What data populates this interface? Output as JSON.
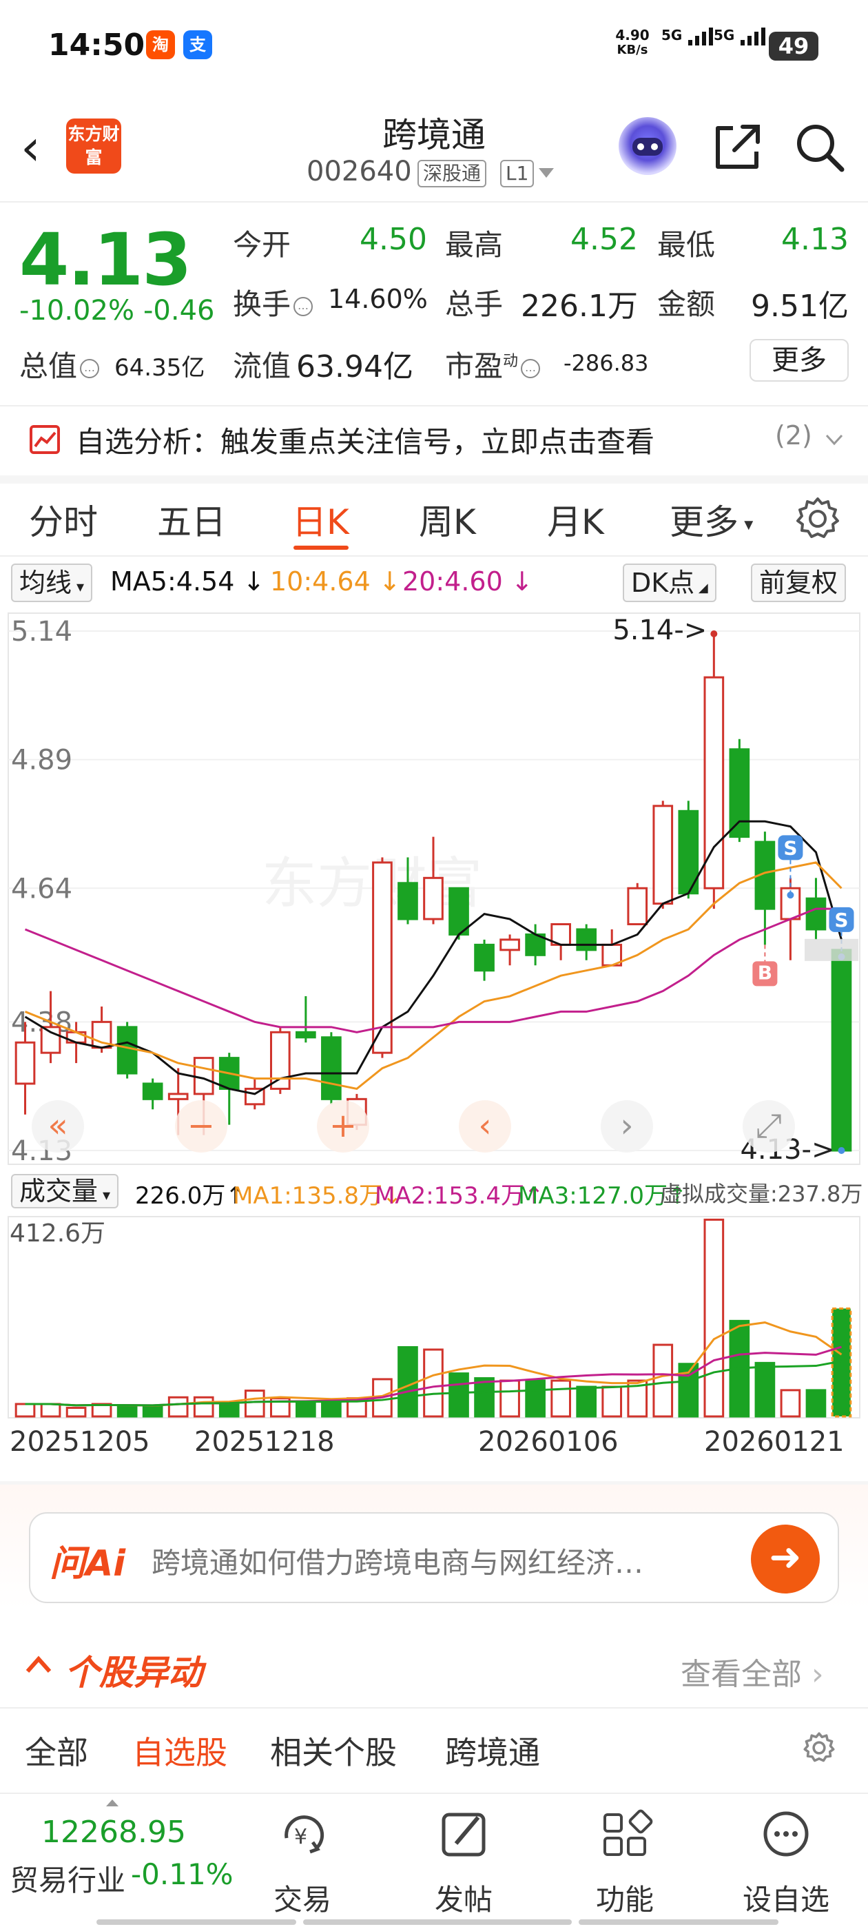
{
  "status_bar": {
    "time": "14:50",
    "apps": [
      {
        "label": "淘",
        "color": "#ff5000"
      },
      {
        "label": "支",
        "color": "#1677ff"
      }
    ],
    "net_speed": "4.90",
    "net_unit": "KB/s",
    "sig1": "5G",
    "sig2": "5G",
    "battery": "49"
  },
  "header": {
    "logo": "东方财富",
    "title": "跨境通",
    "code": "002640",
    "market_tag": "深股通",
    "level_tag": "L1"
  },
  "quote": {
    "price": "4.13",
    "change_pct": "-10.02%",
    "change": "-0.46",
    "open_label": "今开",
    "open": "4.50",
    "high_label": "最高",
    "high": "4.52",
    "low_label": "最低",
    "low": "4.13",
    "turnover_label": "换手",
    "turnover": "14.60%",
    "volume_label": "总手",
    "volume": "226.1万",
    "amount_label": "金额",
    "amount": "9.51亿",
    "mktcap_label": "总值",
    "mktcap": "64.35亿",
    "float_label": "流值",
    "float": "63.94亿",
    "pe_label": "市盈",
    "pe_sup": "动",
    "pe": "-286.83",
    "more": "更多"
  },
  "alert": {
    "text": "自选分析：触发重点关注信号，立即点击查看",
    "count": "(2)"
  },
  "tabs": [
    "分时",
    "五日",
    "日K",
    "周K",
    "月K",
    "更多"
  ],
  "active_tab": 2,
  "ma_row": {
    "indicator": "均线",
    "ma5": "MA5:4.54 ↓",
    "ma10": "10:4.64 ↓",
    "ma20": "20:4.60 ↓",
    "dk": "DK点",
    "adjust": "前复权"
  },
  "colors": {
    "up": "#d0342c",
    "down": "#1aa323",
    "ma5": "#111111",
    "ma10": "#f0961e",
    "ma20": "#c21f8c",
    "accent": "#f04a1a"
  },
  "price_axis": [
    "5.14",
    "4.89",
    "4.64",
    "4.38",
    "4.13"
  ],
  "annotations": {
    "high": "5.14->",
    "low": "4.13->",
    "buy": "B",
    "sell": "S"
  },
  "volume_row": {
    "indicator": "成交量",
    "vol": "226.0万↑",
    "ma1": "MA1:135.8万↓",
    "ma2": "MA2:153.4万↑",
    "ma3": "MA3:127.0万↑",
    "virtual": "虚拟成交量:237.8万"
  },
  "volume_axis_max": "412.6万",
  "dates": [
    "20251205",
    "20251218",
    "20260106",
    "20260121"
  ],
  "chart_data": {
    "type": "candlestick",
    "ylim": [
      4.13,
      5.14
    ],
    "candles": [
      {
        "o": 4.26,
        "h": 4.38,
        "l": 4.2,
        "c": 4.34
      },
      {
        "o": 4.32,
        "h": 4.44,
        "l": 4.3,
        "c": 4.37
      },
      {
        "o": 4.34,
        "h": 4.38,
        "l": 4.3,
        "c": 4.36
      },
      {
        "o": 4.33,
        "h": 4.41,
        "l": 4.32,
        "c": 4.38
      },
      {
        "o": 4.37,
        "h": 4.38,
        "l": 4.27,
        "c": 4.28
      },
      {
        "o": 4.26,
        "h": 4.27,
        "l": 4.21,
        "c": 4.23
      },
      {
        "o": 4.23,
        "h": 4.29,
        "l": 4.16,
        "c": 4.24
      },
      {
        "o": 4.24,
        "h": 4.31,
        "l": 4.16,
        "c": 4.31
      },
      {
        "o": 4.31,
        "h": 4.32,
        "l": 4.18,
        "c": 4.25
      },
      {
        "o": 4.22,
        "h": 4.27,
        "l": 4.21,
        "c": 4.25
      },
      {
        "o": 4.25,
        "h": 4.37,
        "l": 4.24,
        "c": 4.36
      },
      {
        "o": 4.36,
        "h": 4.43,
        "l": 4.34,
        "c": 4.35
      },
      {
        "o": 4.35,
        "h": 4.36,
        "l": 4.22,
        "c": 4.23
      },
      {
        "o": 4.18,
        "h": 4.24,
        "l": 4.17,
        "c": 4.23
      },
      {
        "o": 4.32,
        "h": 4.7,
        "l": 4.31,
        "c": 4.69
      },
      {
        "o": 4.65,
        "h": 4.7,
        "l": 4.57,
        "c": 4.58
      },
      {
        "o": 4.58,
        "h": 4.74,
        "l": 4.57,
        "c": 4.66
      },
      {
        "o": 4.64,
        "h": 4.64,
        "l": 4.54,
        "c": 4.55
      },
      {
        "o": 4.53,
        "h": 4.54,
        "l": 4.46,
        "c": 4.48
      },
      {
        "o": 4.52,
        "h": 4.55,
        "l": 4.49,
        "c": 4.54
      },
      {
        "o": 4.55,
        "h": 4.57,
        "l": 4.49,
        "c": 4.51
      },
      {
        "o": 4.53,
        "h": 4.57,
        "l": 4.5,
        "c": 4.57
      },
      {
        "o": 4.56,
        "h": 4.57,
        "l": 4.5,
        "c": 4.52
      },
      {
        "o": 4.49,
        "h": 4.56,
        "l": 4.49,
        "c": 4.53
      },
      {
        "o": 4.57,
        "h": 4.65,
        "l": 4.57,
        "c": 4.64
      },
      {
        "o": 4.61,
        "h": 4.81,
        "l": 4.6,
        "c": 4.8
      },
      {
        "o": 4.79,
        "h": 4.81,
        "l": 4.62,
        "c": 4.63
      },
      {
        "o": 4.64,
        "h": 5.14,
        "l": 4.6,
        "c": 5.05
      },
      {
        "o": 4.91,
        "h": 4.93,
        "l": 4.73,
        "c": 4.74
      },
      {
        "o": 4.73,
        "h": 4.75,
        "l": 4.53,
        "c": 4.6
      },
      {
        "o": 4.58,
        "h": 4.66,
        "l": 4.5,
        "c": 4.64
      },
      {
        "o": 4.62,
        "h": 4.66,
        "l": 4.54,
        "c": 4.56
      },
      {
        "o": 4.52,
        "h": 4.52,
        "l": 4.13,
        "c": 4.13
      }
    ],
    "ma5": [
      4.39,
      4.36,
      4.34,
      4.33,
      4.34,
      4.32,
      4.28,
      4.27,
      4.25,
      4.24,
      4.27,
      4.28,
      4.28,
      4.28,
      4.37,
      4.4,
      4.47,
      4.55,
      4.59,
      4.58,
      4.55,
      4.53,
      4.53,
      4.53,
      4.55,
      4.61,
      4.63,
      4.72,
      4.77,
      4.77,
      4.76,
      4.71,
      4.54
    ],
    "ma10": [
      4.4,
      4.38,
      4.36,
      4.34,
      4.33,
      4.32,
      4.3,
      4.29,
      4.28,
      4.27,
      4.27,
      4.27,
      4.26,
      4.25,
      4.29,
      4.31,
      4.35,
      4.39,
      4.42,
      4.43,
      4.45,
      4.47,
      4.48,
      4.49,
      4.51,
      4.54,
      4.56,
      4.61,
      4.65,
      4.67,
      4.68,
      4.69,
      4.64
    ],
    "ma20": [
      4.56,
      4.54,
      4.52,
      4.5,
      4.48,
      4.46,
      4.44,
      4.42,
      4.4,
      4.38,
      4.37,
      4.37,
      4.37,
      4.36,
      4.37,
      4.37,
      4.37,
      4.38,
      4.38,
      4.38,
      4.39,
      4.4,
      4.4,
      4.41,
      4.42,
      4.44,
      4.47,
      4.51,
      4.54,
      4.56,
      4.58,
      4.6,
      4.6
    ],
    "volume_wan": [
      26,
      26,
      18,
      26,
      22,
      22,
      40,
      40,
      30,
      54,
      38,
      30,
      30,
      38,
      78,
      145,
      140,
      90,
      80,
      75,
      75,
      75,
      62,
      62,
      75,
      150,
      110,
      412,
      200,
      112,
      55,
      55,
      226
    ],
    "volume_ylim": [
      0,
      412.6
    ],
    "signals": [
      {
        "index": 29,
        "type": "B"
      },
      {
        "index": 30,
        "type": "S"
      },
      {
        "index": 32,
        "type": "S"
      }
    ]
  },
  "ai": {
    "badge": "问Ai",
    "text": "跨境通如何借力跨境电商与网红经济…"
  },
  "movement": {
    "title": "个股异动",
    "view_all": "查看全部"
  },
  "subtabs": [
    "全部",
    "自选股",
    "相关个股",
    "跨境通"
  ],
  "active_subtab": 1,
  "navbar": {
    "index_value": "12268.95",
    "index_name": "贸易行业",
    "index_change": "-0.11%",
    "items": [
      "交易",
      "发帖",
      "功能",
      "设自选"
    ]
  }
}
